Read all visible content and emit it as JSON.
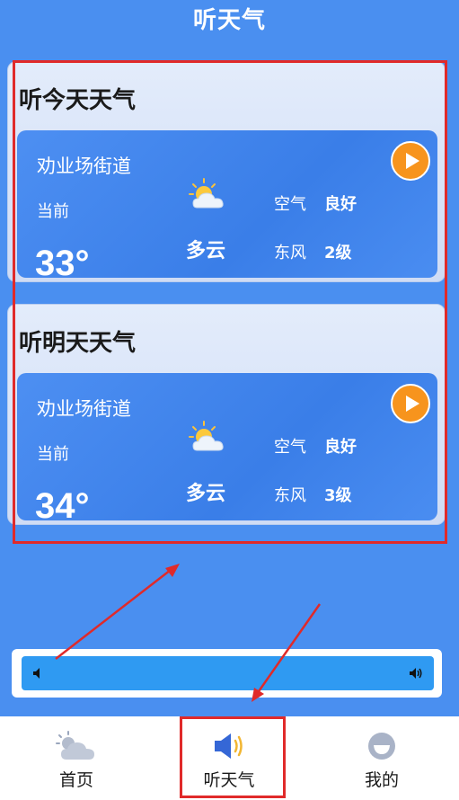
{
  "header": {
    "title": "听天气"
  },
  "cards": [
    {
      "title": "听今天天气",
      "location": "劝业场街道",
      "current_label": "当前",
      "temperature": "33°",
      "condition": "多云",
      "condition_icon": "partly-cloudy-icon",
      "air_label": "空气",
      "air_value": "良好",
      "wind_direction": "东风",
      "wind_level": "2级",
      "play_icon": "play-icon"
    },
    {
      "title": "听明天天气",
      "location": "劝业场街道",
      "current_label": "当前",
      "temperature": "34°",
      "condition": "多云",
      "condition_icon": "partly-cloudy-icon",
      "air_label": "空气",
      "air_value": "良好",
      "wind_direction": "东风",
      "wind_level": "3级",
      "play_icon": "play-icon"
    }
  ],
  "player": {
    "left_icon": "volume-low-icon",
    "right_icon": "volume-high-icon"
  },
  "tabs": [
    {
      "label": "首页",
      "icon": "weather-cloud-icon"
    },
    {
      "label": "听天气",
      "icon": "speaker-icon",
      "active": true
    },
    {
      "label": "我的",
      "icon": "user-face-icon"
    }
  ],
  "colors": {
    "background": "#4a8ff0",
    "panel": "#3a7ee8",
    "play_button": "#f7941d",
    "annotation": "#e02a2a",
    "player_track": "#2f9af2"
  }
}
